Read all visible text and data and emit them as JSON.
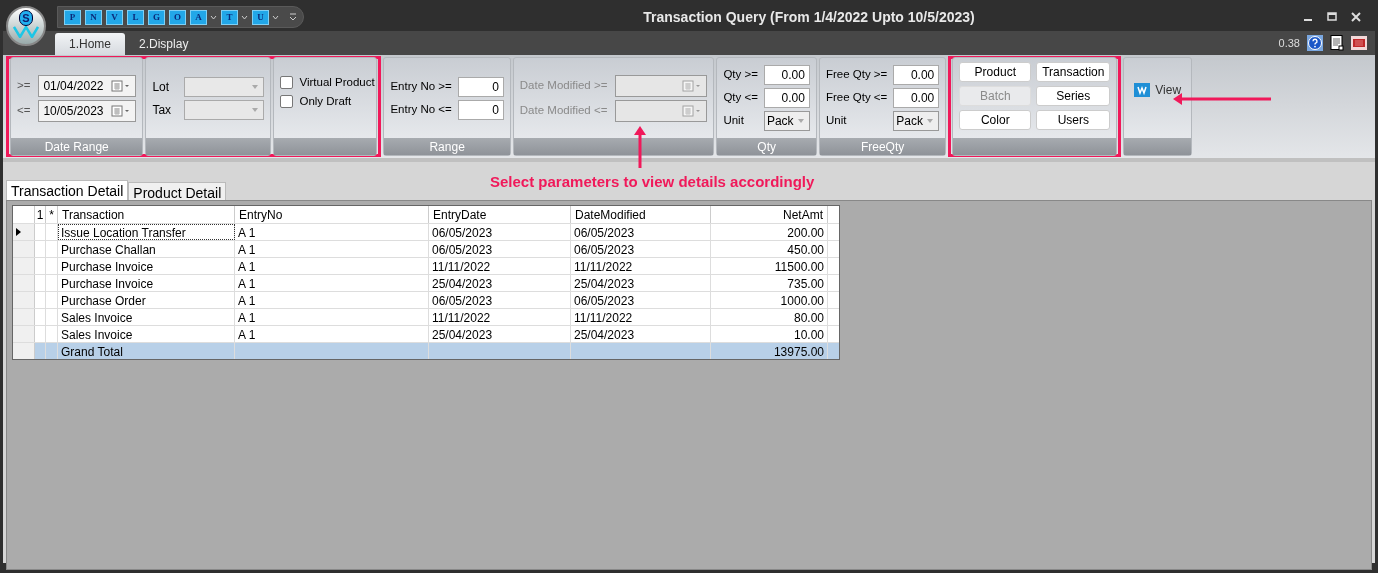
{
  "logo_letter": "S",
  "quick_access": [
    {
      "letter": "P",
      "dropdown": false
    },
    {
      "letter": "N",
      "dropdown": false
    },
    {
      "letter": "V",
      "dropdown": false
    },
    {
      "letter": "L",
      "dropdown": false
    },
    {
      "letter": "G",
      "dropdown": false
    },
    {
      "letter": "O",
      "dropdown": false
    },
    {
      "letter": "A",
      "dropdown": true
    },
    {
      "letter": "T",
      "dropdown": true
    },
    {
      "letter": "U",
      "dropdown": true
    }
  ],
  "window": {
    "title": "Transaction Query (From 1/4/2022 Upto 10/5/2023)"
  },
  "ribbon_tabs": [
    {
      "label": "1.Home",
      "selected": true
    },
    {
      "label": "2.Display",
      "selected": false
    }
  ],
  "version": "0.38",
  "ribbon": {
    "sections": [
      {
        "highlighted": true,
        "groups": [
          {
            "kind": "date_range",
            "caption": "Date Range",
            "disabled": false,
            "rows": [
              {
                "label": ">=",
                "value": "01/04/2022"
              },
              {
                "label": "<=",
                "value": "10/05/2023"
              }
            ]
          },
          {
            "kind": "combos",
            "rows": [
              {
                "label": "Lot",
                "disabled": true
              },
              {
                "label": "Tax",
                "disabled": true
              }
            ]
          },
          {
            "kind": "checkboxes",
            "items": [
              {
                "label": "Virtual Product",
                "checked": false
              },
              {
                "label": "Only Draft",
                "checked": false
              }
            ]
          }
        ]
      },
      {
        "highlighted": false,
        "groups": [
          {
            "kind": "numbers",
            "caption": "Range",
            "rows": [
              {
                "label": "Entry No >=",
                "value": "0"
              },
              {
                "label": "Entry No <=",
                "value": "0"
              }
            ]
          },
          {
            "kind": "date_range",
            "disabled": true,
            "rows": [
              {
                "label": "Date Modified >="
              },
              {
                "label": "Date Modified <="
              }
            ]
          },
          {
            "kind": "qty",
            "caption": "Qty",
            "rows": [
              {
                "label": "Qty >=",
                "value": "0.00"
              },
              {
                "label": "Qty <=",
                "value": "0.00"
              }
            ],
            "unit": {
              "label": "Unit",
              "value": "Pack"
            }
          },
          {
            "kind": "qty",
            "caption": "FreeQty",
            "rows": [
              {
                "label": "Free Qty >=",
                "value": "0.00"
              },
              {
                "label": "Free Qty <=",
                "value": "0.00"
              }
            ],
            "unit": {
              "label": "Unit",
              "value": "Pack"
            }
          }
        ]
      },
      {
        "highlighted": true,
        "groups": [
          {
            "kind": "buttons",
            "items": [
              {
                "label": "Product",
                "disabled": false
              },
              {
                "label": "Transaction",
                "disabled": false
              },
              {
                "label": "Batch",
                "disabled": true
              },
              {
                "label": "Series",
                "disabled": false
              },
              {
                "label": "Color",
                "disabled": false
              },
              {
                "label": "Users",
                "disabled": false
              }
            ]
          }
        ]
      },
      {
        "highlighted": false,
        "groups": [
          {
            "kind": "view",
            "label": "View"
          }
        ]
      }
    ]
  },
  "annotation": {
    "caption": "Select parameters to view details accordingly"
  },
  "doc_tabs": [
    {
      "label": "Transaction Detail",
      "selected": true
    },
    {
      "label": "Product Detail",
      "selected": false
    }
  ],
  "grid": {
    "columns": [
      "1",
      "*",
      "Transaction",
      "EntryNo",
      "EntryDate",
      "DateModified",
      "NetAmt"
    ],
    "rows": [
      {
        "kind": "data",
        "selected": true,
        "cells": [
          "",
          "",
          "Issue Location Transfer",
          "A 1",
          "06/05/2023",
          "06/05/2023",
          "200.00"
        ]
      },
      {
        "kind": "data",
        "selected": false,
        "cells": [
          "",
          "",
          "Purchase Challan",
          "A 1",
          "06/05/2023",
          "06/05/2023",
          "450.00"
        ]
      },
      {
        "kind": "data",
        "selected": false,
        "cells": [
          "",
          "",
          "Purchase Invoice",
          "A 1",
          "11/11/2022",
          "11/11/2022",
          "11500.00"
        ]
      },
      {
        "kind": "data",
        "selected": false,
        "cells": [
          "",
          "",
          "Purchase Invoice",
          "A 1",
          "25/04/2023",
          "25/04/2023",
          "735.00"
        ]
      },
      {
        "kind": "data",
        "selected": false,
        "cells": [
          "",
          "",
          "Purchase Order",
          "A 1",
          "06/05/2023",
          "06/05/2023",
          "1000.00"
        ]
      },
      {
        "kind": "data",
        "selected": false,
        "cells": [
          "",
          "",
          "Sales Invoice",
          "A 1",
          "11/11/2022",
          "11/11/2022",
          "80.00"
        ]
      },
      {
        "kind": "data",
        "selected": false,
        "cells": [
          "",
          "",
          "Sales Invoice",
          "A 1",
          "25/04/2023",
          "25/04/2023",
          "10.00"
        ]
      },
      {
        "kind": "total",
        "selected": false,
        "cells": [
          "",
          "",
          "Grand Total",
          "",
          "",
          "",
          "13975.00"
        ]
      }
    ]
  }
}
